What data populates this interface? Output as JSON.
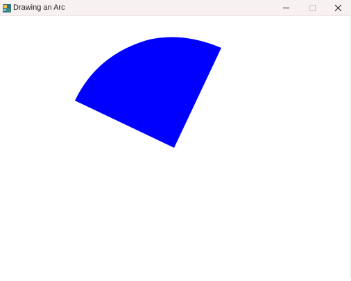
{
  "window": {
    "title": "Drawing an Arc"
  },
  "icons": {
    "app": "app-icon",
    "minimize": "minimize-icon",
    "maximize": "maximize-icon",
    "close": "close-icon"
  },
  "arc": {
    "fill_color": "#0000ff",
    "shape": "pie-slice"
  }
}
